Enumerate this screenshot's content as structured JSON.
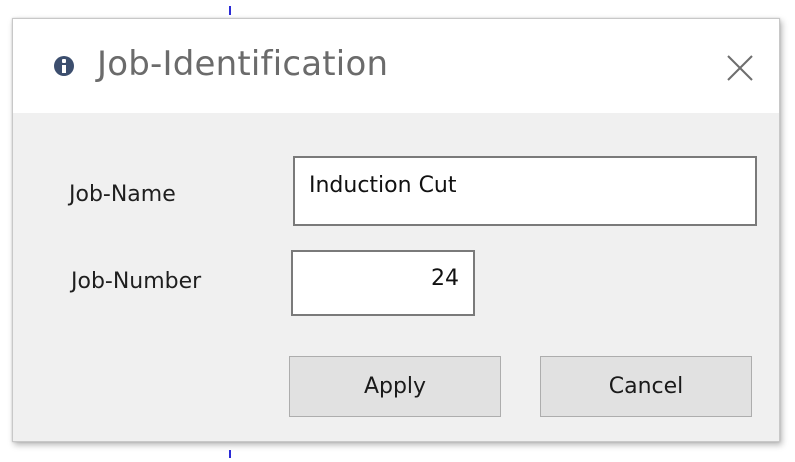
{
  "dialog": {
    "title": "Job-Identification",
    "title_icon": "info-icon",
    "close_icon": "close-icon"
  },
  "form": {
    "job_name_label": "Job-Name",
    "job_name_value": "Induction Cut",
    "job_number_label": "Job-Number",
    "job_number_value": "24"
  },
  "buttons": {
    "apply_label": "Apply",
    "cancel_label": "Cancel"
  },
  "colors": {
    "title_text": "#6b6b6b",
    "dialog_body": "#f0f0f0",
    "titlebar": "#ffffff",
    "button_face": "#e1e1e1",
    "info_icon": "#3c4e6e"
  }
}
